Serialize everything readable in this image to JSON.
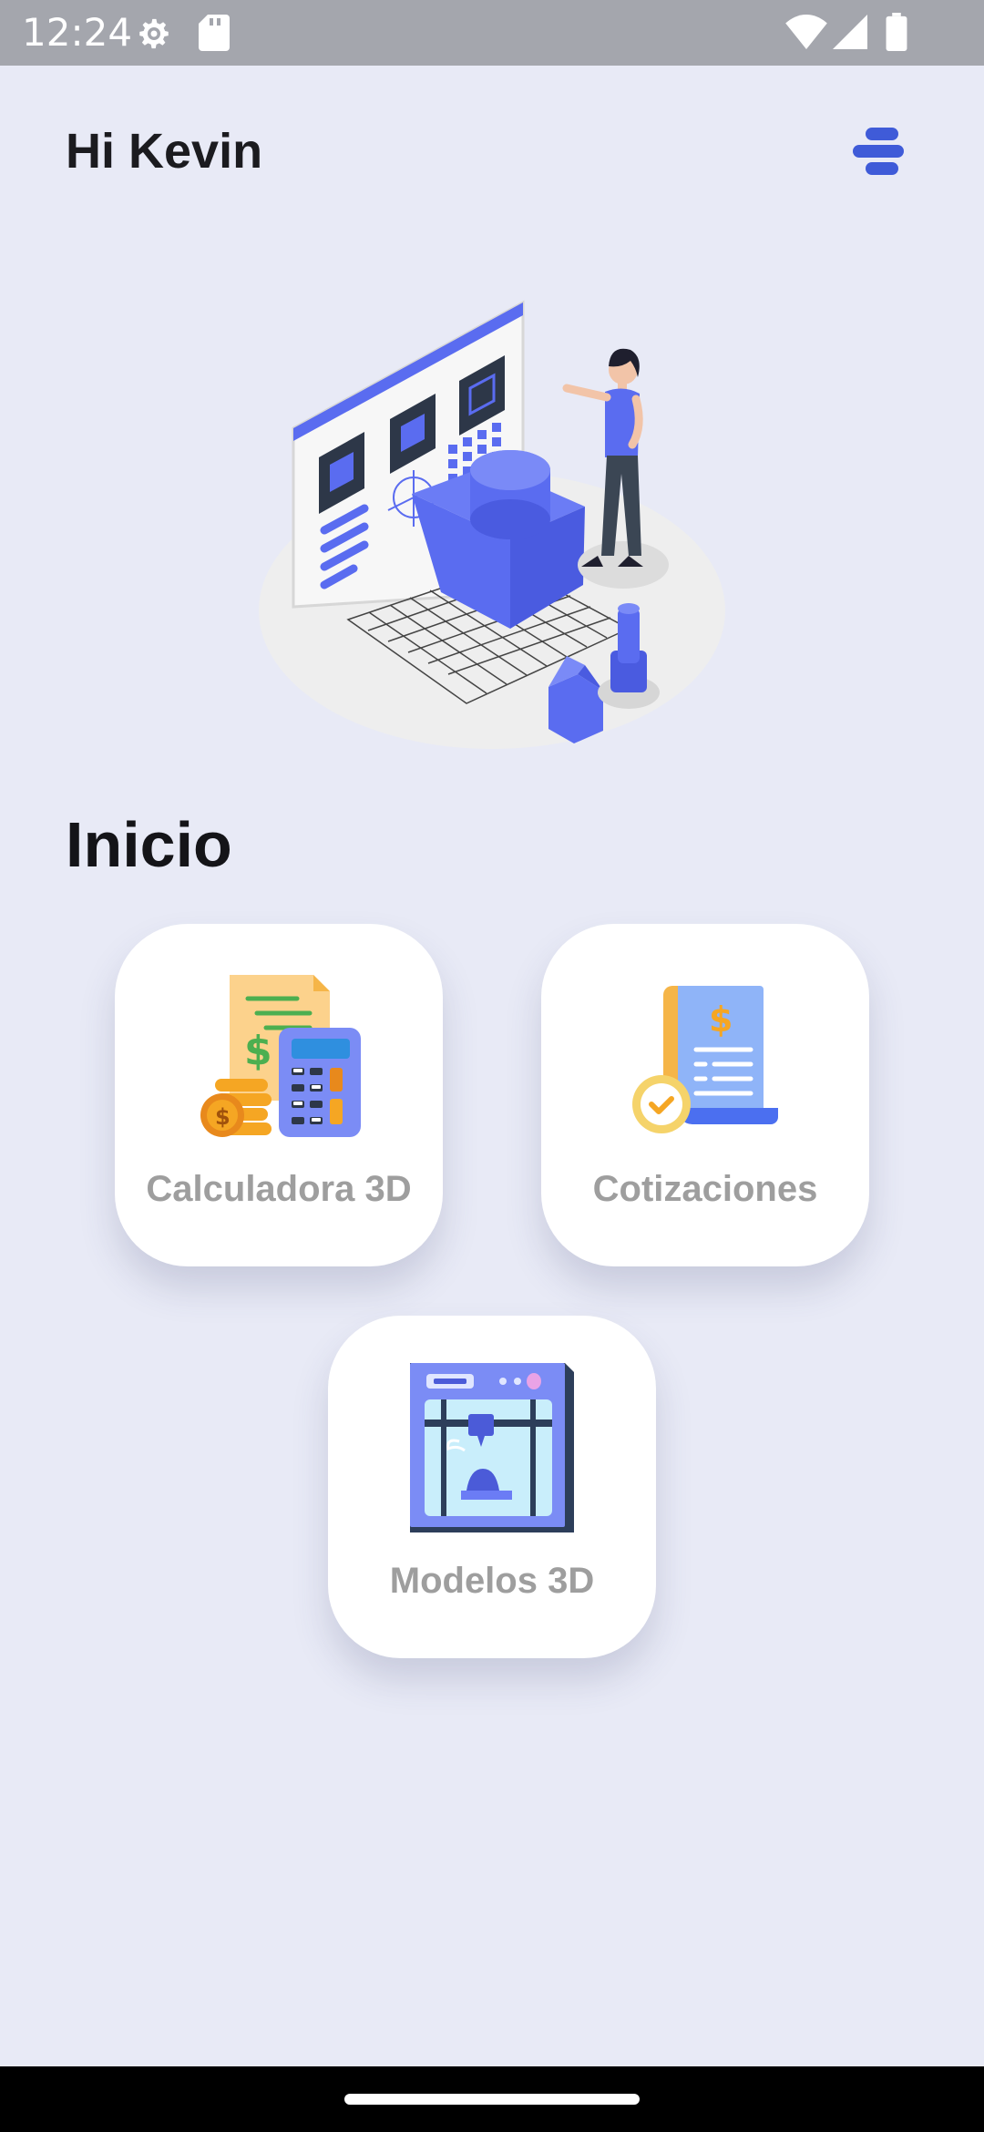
{
  "status_bar": {
    "time": "12:24",
    "icons": [
      "settings-icon",
      "sd-card-icon",
      "wifi-icon",
      "signal-icon",
      "battery-icon"
    ],
    "background": "#a4a6ad"
  },
  "header": {
    "greeting": "Hi Kevin",
    "menu_icon": "menu-icon",
    "accent": "#3f5bd8"
  },
  "hero": {
    "illustration": "3d-design-illustration"
  },
  "main": {
    "title": "Inicio",
    "cards": [
      {
        "label": "Calculadora 3D",
        "icon": "calculator-money-icon"
      },
      {
        "label": "Cotizaciones",
        "icon": "quote-document-icon"
      },
      {
        "label": "Modelos 3D",
        "icon": "3d-printer-icon"
      }
    ]
  },
  "colors": {
    "background": "#e8eaf6",
    "card": "#ffffff",
    "card_label": "#9e9e9e",
    "illustration_blue": "#5a6cf0"
  }
}
